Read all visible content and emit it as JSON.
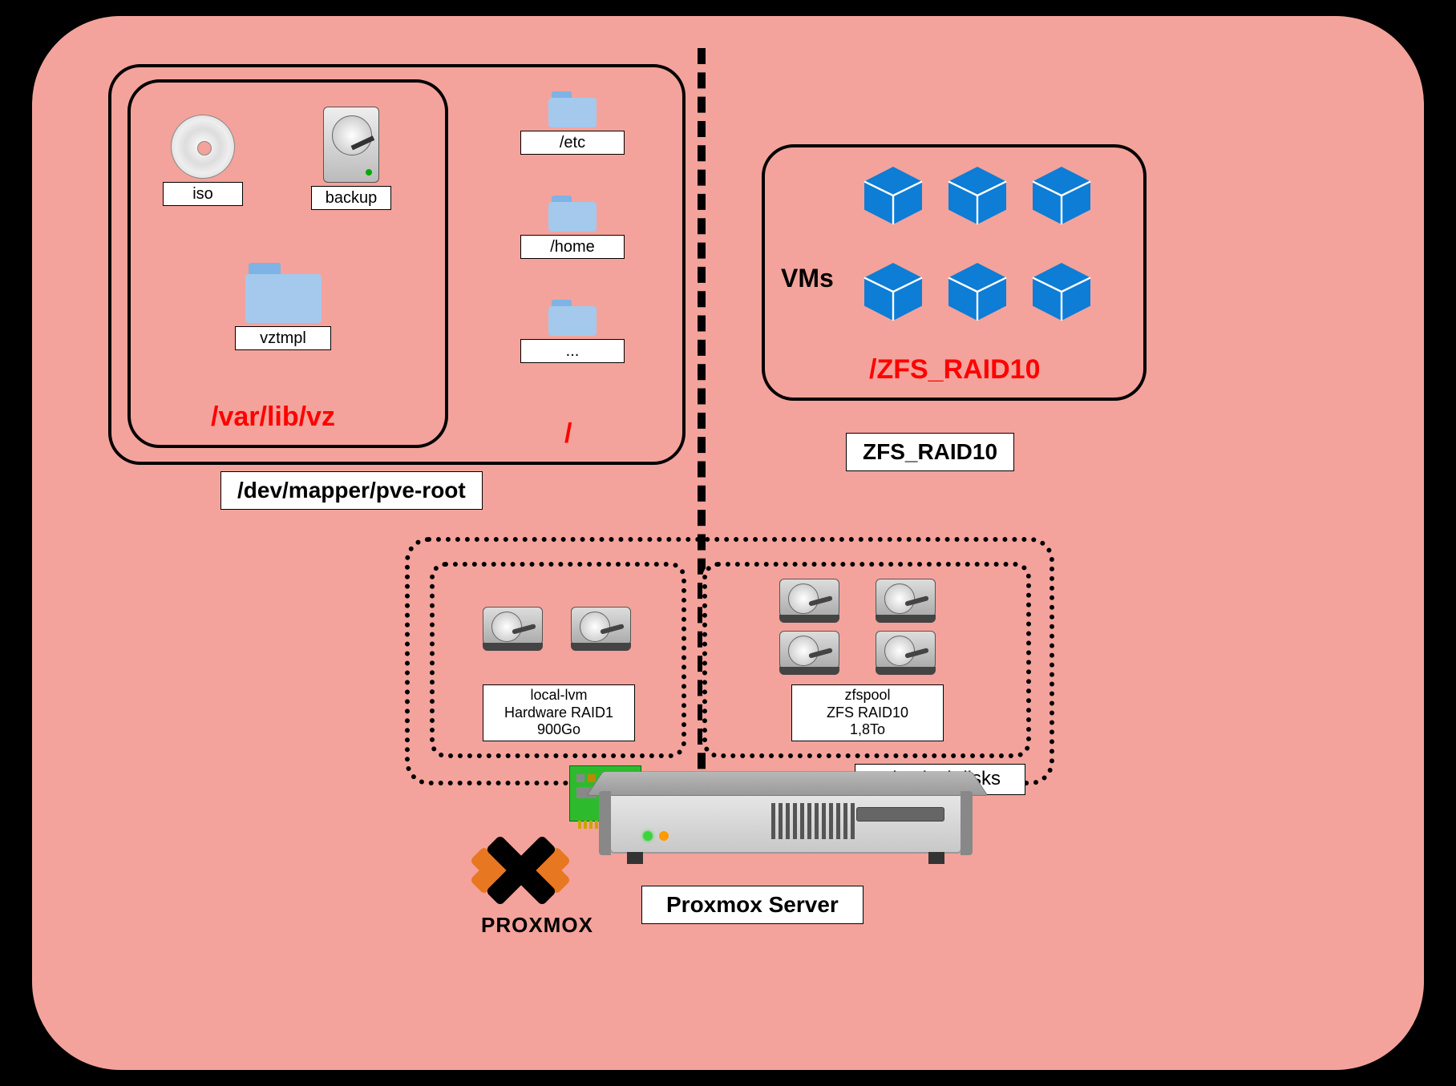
{
  "pveroot": {
    "label": "/dev/mapper/pve-root",
    "varlibvz": {
      "path": "/var/lib/vz",
      "items": {
        "iso": "iso",
        "backup": "backup",
        "vztmpl": "vztmpl"
      }
    },
    "root": {
      "path": "/",
      "folders": {
        "etc": "/etc",
        "home": "/home",
        "more": "..."
      }
    }
  },
  "zfs": {
    "label": "ZFS_RAID10",
    "mount": "/ZFS_RAID10",
    "vms_label": "VMs"
  },
  "physdisks": {
    "label": "Physical disks",
    "group1": {
      "name": "local-lvm",
      "type": "Hardware RAID1",
      "size": "900Go"
    },
    "group2": {
      "name": "zfspool",
      "type": "ZFS RAID10",
      "size": "1,8To"
    }
  },
  "server": {
    "label": "Proxmox Server",
    "brand": "PROXMOX"
  }
}
